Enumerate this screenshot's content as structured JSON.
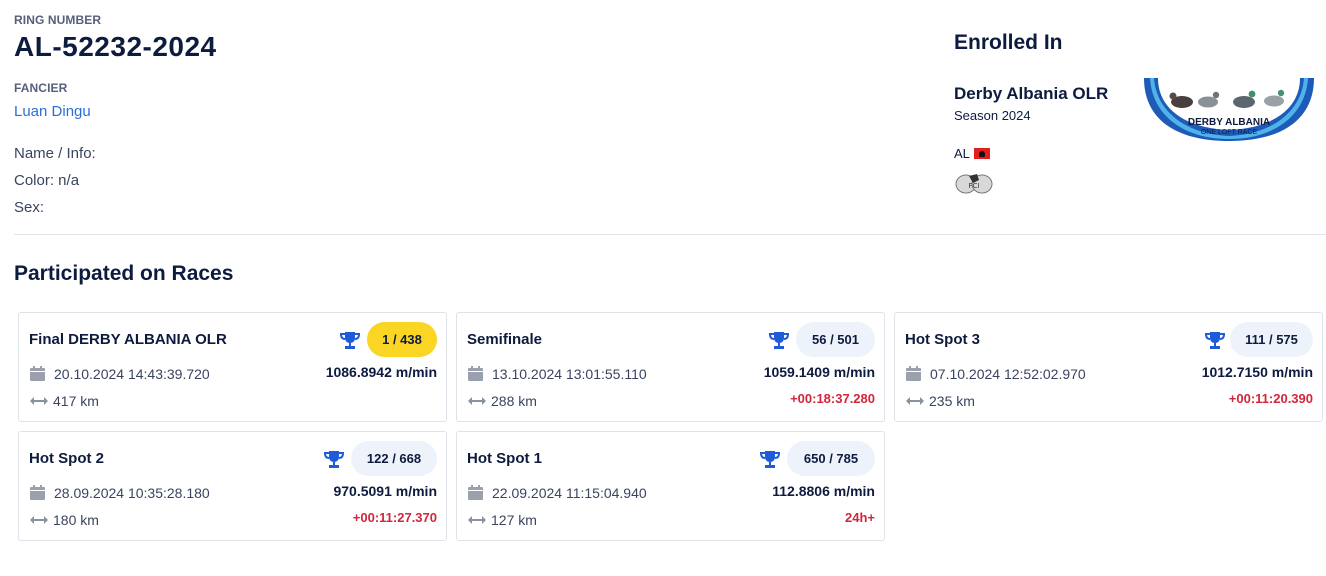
{
  "header": {
    "ring_label": "RING NUMBER",
    "ring_number": "AL-52232-2024",
    "fancier_label": "FANCIER",
    "fancier_name": "Luan Dingu",
    "name_info": "Name / Info:",
    "color": "Color: n/a",
    "sex": "Sex:"
  },
  "enrolled": {
    "title": "Enrolled In",
    "race_name": "Derby Albania OLR",
    "season": "Season 2024",
    "country_code": "AL",
    "logo_text_main": "DERBY ALBANIA",
    "logo_text_sub": "ONE LOFT RACE",
    "fci_text": "FCI"
  },
  "races_section": {
    "title": "Participated on Races"
  },
  "races": [
    {
      "name": "Final DERBY ALBANIA OLR",
      "rank": "1 / 438",
      "rank_style": "gold",
      "date": "20.10.2024 14:43:39.720",
      "speed": "1086.8942 m/min",
      "distance": "417 km",
      "difference": ""
    },
    {
      "name": "Semifinale",
      "rank": "56 / 501",
      "rank_style": "plain",
      "date": "13.10.2024 13:01:55.110",
      "speed": "1059.1409 m/min",
      "distance": "288 km",
      "difference": "+00:18:37.280"
    },
    {
      "name": "Hot Spot 3",
      "rank": "111 / 575",
      "rank_style": "plain",
      "date": "07.10.2024 12:52:02.970",
      "speed": "1012.7150 m/min",
      "distance": "235 km",
      "difference": "+00:11:20.390"
    },
    {
      "name": "Hot Spot 2",
      "rank": "122 / 668",
      "rank_style": "plain",
      "date": "28.09.2024 10:35:28.180",
      "speed": "970.5091 m/min",
      "distance": "180 km",
      "difference": "+00:11:27.370"
    },
    {
      "name": "Hot Spot 1",
      "rank": "650 / 785",
      "rank_style": "plain",
      "date": "22.09.2024 11:15:04.940",
      "speed": "112.8806 m/min",
      "distance": "127 km",
      "difference": "24h+"
    }
  ],
  "colors": {
    "accent": "#2a6fd6",
    "gold_badge": "#fbd524",
    "negative": "#d2263a",
    "text_dark": "#0d1b3e"
  },
  "icons": {
    "trophy": "trophy-icon",
    "calendar": "calendar-icon",
    "distance": "distance-arrows-icon",
    "flag": "albania-flag-icon"
  }
}
